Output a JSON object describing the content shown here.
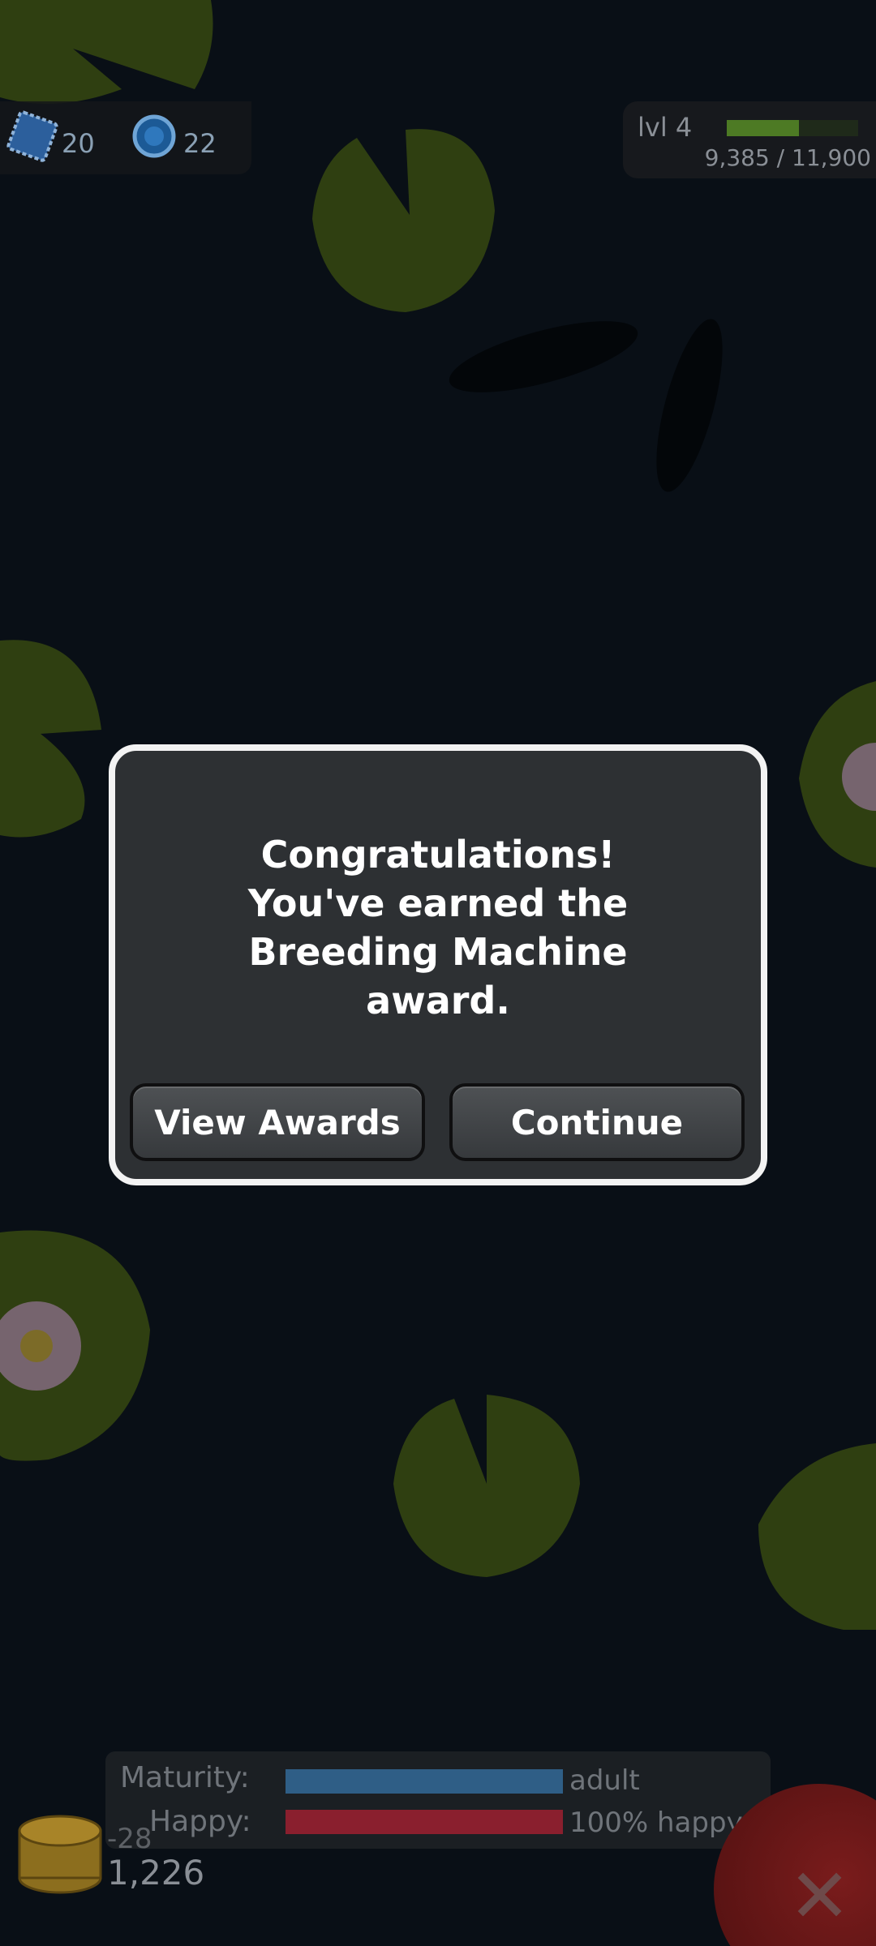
{
  "hud": {
    "gems": "20",
    "pearls": "22",
    "level": "lvl 4",
    "xp_text": "9,385 / 11,900",
    "xp_fraction": 0.55
  },
  "dialog": {
    "message": "Congratulations!\nYou've earned the\nBreeding Machine\naward.",
    "view_awards": "View Awards",
    "continue": "Continue"
  },
  "status": {
    "maturity_label": "Maturity:",
    "maturity_value": "adult",
    "happy_label": "Happy:",
    "happy_value": "100% happy",
    "coin_delta": "-28",
    "coin_total": "1,226"
  },
  "colors": {
    "maturity_bar": "#2f5e86",
    "happy_bar": "#8a1f2e",
    "lily_pad": "#4e6a1e"
  },
  "icons": {
    "gem": "blue-stamp-icon",
    "pearl": "blue-orb-icon",
    "coins": "gold-coin-stack-icon",
    "close": "close-x-icon"
  }
}
